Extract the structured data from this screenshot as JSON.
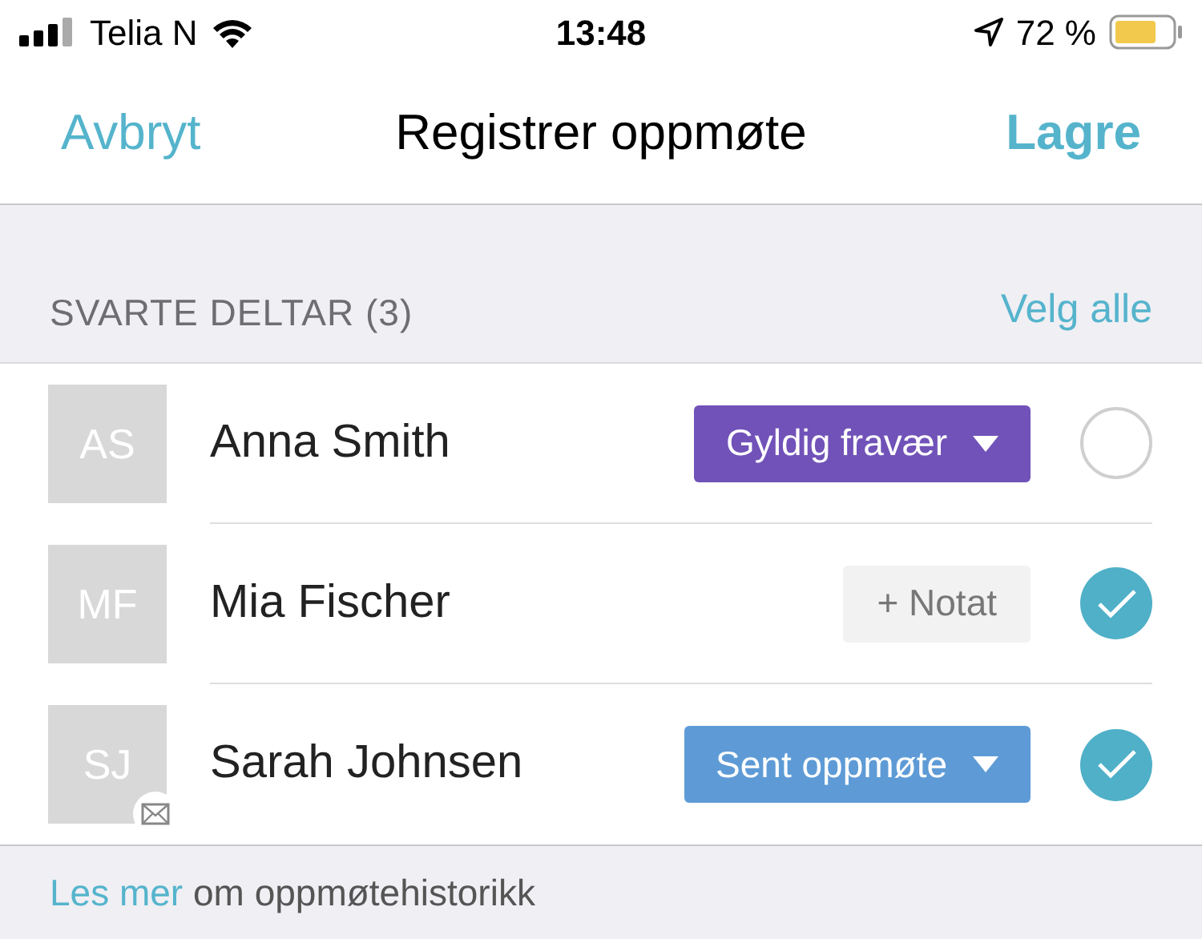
{
  "status_bar": {
    "carrier": "Telia N",
    "time": "13:48",
    "battery": "72 %"
  },
  "nav": {
    "cancel": "Avbryt",
    "title": "Registrer oppmøte",
    "save": "Lagre"
  },
  "section": {
    "title": "SVARTE DELTAR (3)",
    "action": "Velg alle"
  },
  "rows": [
    {
      "initials": "AS",
      "name": "Anna Smith",
      "tag": {
        "kind": "dropdown",
        "label": "Gyldig fravær",
        "color": "#7152b8"
      },
      "checked": false,
      "message_badge": false
    },
    {
      "initials": "MF",
      "name": "Mia Fischer",
      "tag": {
        "kind": "note",
        "label": "+ Notat"
      },
      "checked": true,
      "message_badge": false
    },
    {
      "initials": "SJ",
      "name": "Sarah Johnsen",
      "tag": {
        "kind": "dropdown",
        "label": "Sent oppmøte",
        "color": "#5e9bd6"
      },
      "checked": true,
      "message_badge": true
    }
  ],
  "footer": {
    "link": "Les mer",
    "text": " om oppmøtehistorikk"
  }
}
